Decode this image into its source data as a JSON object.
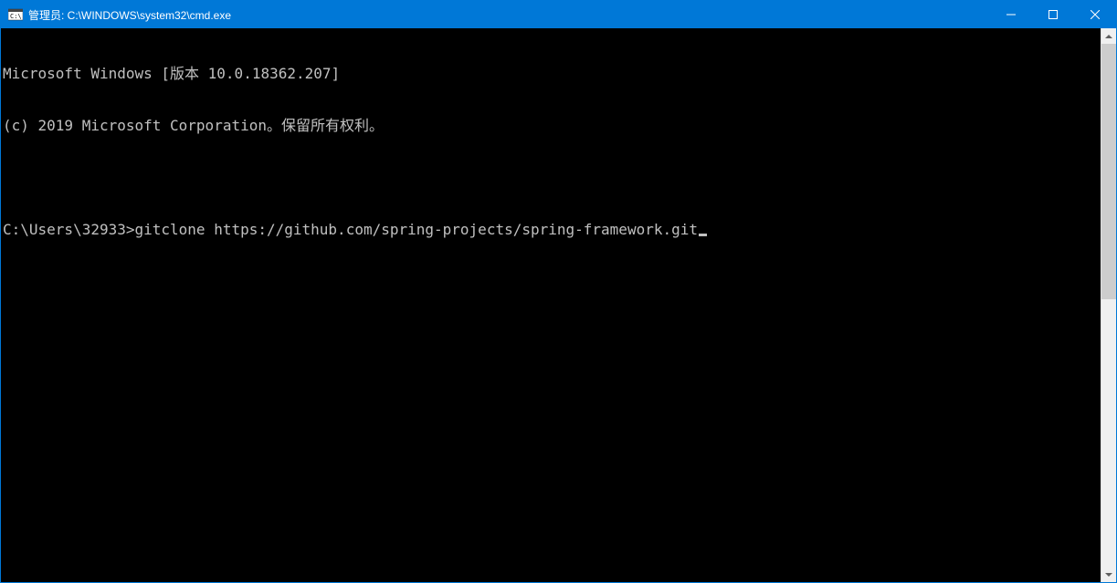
{
  "titlebar": {
    "title": "管理员: C:\\WINDOWS\\system32\\cmd.exe"
  },
  "terminal": {
    "line1": "Microsoft Windows [版本 10.0.18362.207]",
    "line2": "(c) 2019 Microsoft Corporation。保留所有权利。",
    "line3_prompt": "C:\\Users\\32933>",
    "line3_command": "gitclone https://github.com/spring-projects/spring-framework.git"
  }
}
